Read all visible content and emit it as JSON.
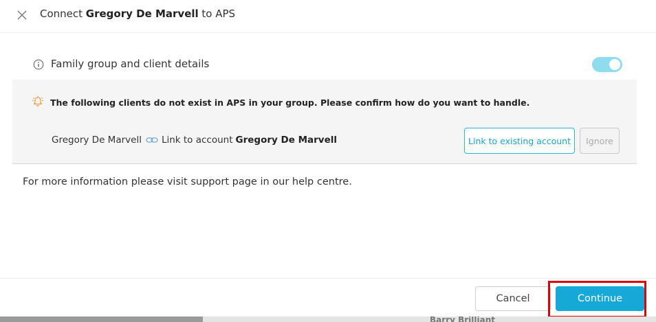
{
  "header": {
    "title_prefix": "Connect ",
    "client_name": "Gregory De Marvell",
    "title_suffix": " to APS"
  },
  "section": {
    "label": "Family group and client details",
    "toggle_on": true
  },
  "warning": {
    "message": "The following clients do not exist in APS in your group. Please confirm how do you want to handle."
  },
  "client_row": {
    "client_name": "Gregory De Marvell",
    "link_text": "Link to account",
    "account_name": "Gregory De Marvell",
    "link_existing_label": "Link to existing account",
    "ignore_label": "Ignore"
  },
  "info": {
    "text": "For more information please visit support page in our help centre."
  },
  "footer": {
    "cancel_label": "Cancel",
    "continue_label": "Continue"
  },
  "background": {
    "partial_name": "Barry Brilliant"
  },
  "colors": {
    "accent": "#16a8d6",
    "toggle": "#8fdcee",
    "highlight": "#e00000",
    "warning_icon": "#f08a24"
  }
}
